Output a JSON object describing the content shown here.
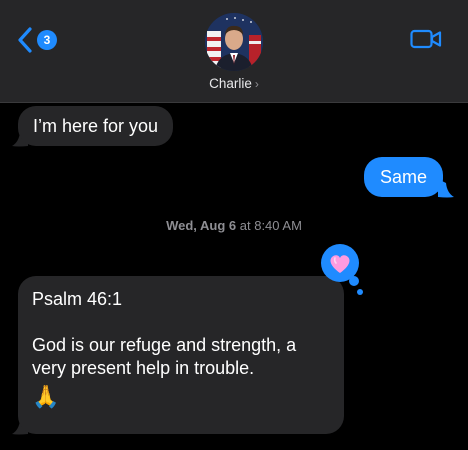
{
  "header": {
    "back_badge_count": "3",
    "contact_name": "Charlie",
    "contact_chevron": "›"
  },
  "messages": [
    {
      "direction": "incoming",
      "text": "I’m here for you"
    },
    {
      "direction": "outgoing",
      "text": "Same"
    },
    {
      "direction": "incoming",
      "lines": [
        "Psalm 46:1",
        "God is our refuge and strength, a",
        "very present help in trouble."
      ],
      "emoji": "🙏"
    }
  ],
  "timestamp": {
    "day": "Wed, Aug 6",
    "at": "at",
    "time": "8:40 AM"
  },
  "tapback": {
    "reaction": "heart",
    "icon": "heart-icon"
  },
  "colors": {
    "accent": "#1f8bff",
    "incoming_bubble": "#262628",
    "header_bg": "#262628",
    "background": "#000000",
    "tapback_heart": "#ff8fd8"
  },
  "icons": [
    "back-chevron-icon",
    "video-camera-icon",
    "heart-icon"
  ]
}
